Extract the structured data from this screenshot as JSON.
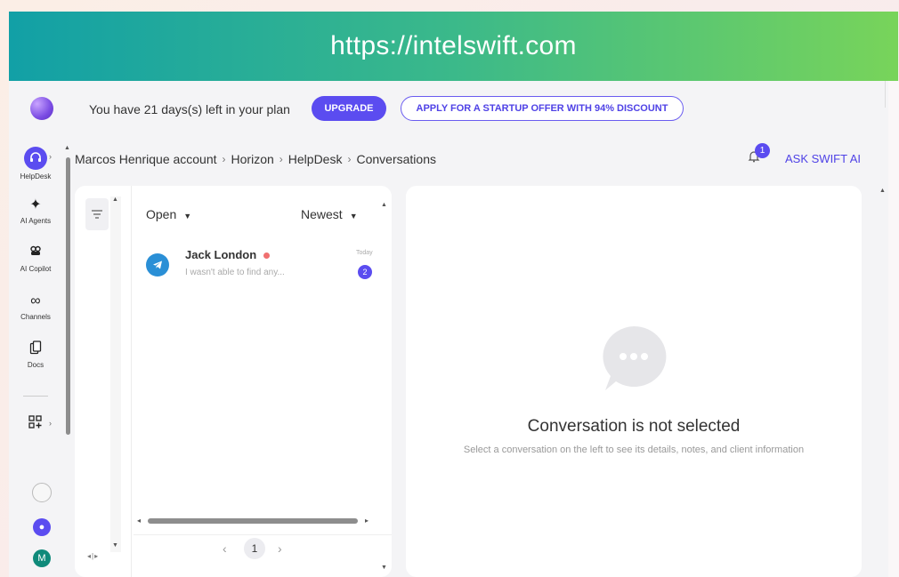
{
  "banner": {
    "url": "https://intelswift.com"
  },
  "topbar": {
    "plan_text": "You have 21 days(s) left in your plan",
    "upgrade_label": "UPGRADE",
    "offer_label": "APPLY FOR A STARTUP OFFER WITH 94% DISCOUNT"
  },
  "sidebar": {
    "items": [
      {
        "label": "HelpDesk",
        "icon": "headset-icon"
      },
      {
        "label": "AI Agents",
        "icon": "sparkle-icon"
      },
      {
        "label": "AI Copilot",
        "icon": "copilot-icon"
      },
      {
        "label": "Channels",
        "icon": "channels-icon"
      },
      {
        "label": "Docs",
        "icon": "docs-icon"
      }
    ],
    "avatar_initial": "M"
  },
  "breadcrumb": {
    "items": [
      "Marcos Henrique account",
      "Horizon",
      "HelpDesk",
      "Conversations"
    ]
  },
  "header": {
    "notification_count": "1",
    "ask_ai_label": "ASK SWIFT AI"
  },
  "conversations": {
    "status_filter": "Open",
    "sort": "Newest",
    "items": [
      {
        "name": "Jack London",
        "preview": "I wasn't able to find any...",
        "time": "Today",
        "unread": "2",
        "channel_icon": "telegram-icon"
      }
    ],
    "pagination": {
      "current_page": "1"
    }
  },
  "empty_state": {
    "title": "Conversation is not selected",
    "subtitle": "Select a conversation on the left to see its details, notes, and client information"
  },
  "colors": {
    "accent": "#5b4cf0",
    "banner_start": "#12a0a6",
    "banner_end": "#78d45a"
  }
}
